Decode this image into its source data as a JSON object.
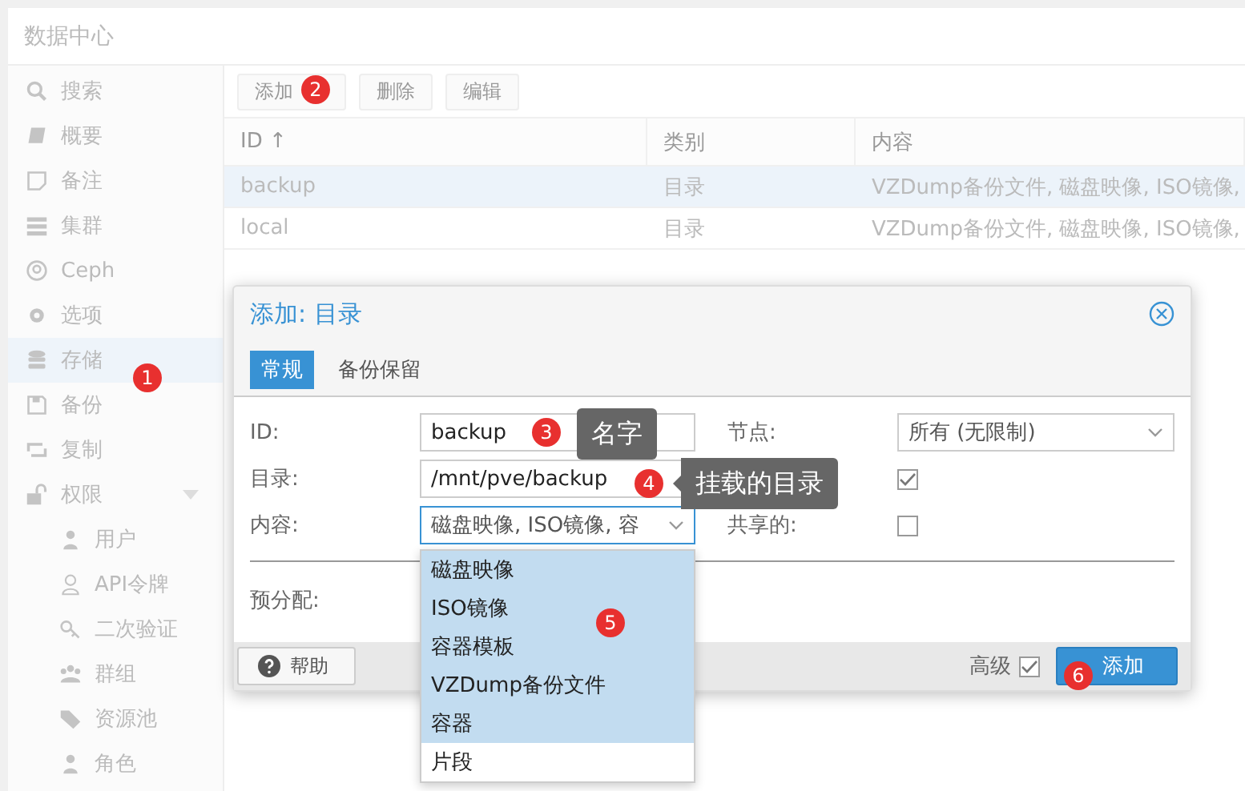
{
  "header": {
    "title": "数据中心"
  },
  "sidebar": {
    "items": [
      {
        "label": "搜索",
        "selected": false
      },
      {
        "label": "概要",
        "selected": false
      },
      {
        "label": "备注",
        "selected": false
      },
      {
        "label": "集群",
        "selected": false
      },
      {
        "label": "Ceph",
        "selected": false
      },
      {
        "label": "选项",
        "selected": false
      },
      {
        "label": "存储",
        "selected": true
      },
      {
        "label": "备份",
        "selected": false
      },
      {
        "label": "复制",
        "selected": false
      },
      {
        "label": "权限",
        "selected": false,
        "expanded": true,
        "children": [
          {
            "label": "用户",
            "selected": false
          },
          {
            "label": "API令牌",
            "selected": false
          },
          {
            "label": "二次验证",
            "selected": false
          },
          {
            "label": "群组",
            "selected": false
          },
          {
            "label": "资源池",
            "selected": false
          },
          {
            "label": "角色",
            "selected": false
          }
        ]
      }
    ]
  },
  "toolbar": {
    "buttons": [
      "添加",
      "删除",
      "编辑"
    ]
  },
  "table": {
    "columns": [
      "ID ↑",
      "类别",
      "内容"
    ],
    "rows": [
      {
        "cells": [
          "backup",
          "目录",
          "VZDump备份文件, 磁盘映像, ISO镜像,"
        ],
        "selected": true
      },
      {
        "cells": [
          "local",
          "目录",
          "VZDump备份文件, 磁盘映像, ISO镜像,"
        ],
        "selected": false
      }
    ]
  },
  "dialog": {
    "title": "添加: 目录",
    "tabs": [
      {
        "label": "常规",
        "selected": true
      },
      {
        "label": "备份保留",
        "selected": false
      }
    ],
    "left_fields": [
      {
        "kind": "text",
        "label": "ID:",
        "value": "backup"
      },
      {
        "kind": "text",
        "label": "目录:",
        "value": "/mnt/pve/backup"
      },
      {
        "kind": "combo",
        "label": "内容:",
        "value": "磁盘映像, ISO镜像, 容"
      }
    ],
    "right_fields": [
      {
        "kind": "combo",
        "label": "节点:",
        "value": "所有 (无限制)"
      },
      {
        "kind": "checkbox",
        "checked": true
      },
      {
        "kind": "checkbox",
        "label": "共享的:",
        "checked": false
      }
    ],
    "lower_fields": [
      {
        "label": "预分配:"
      }
    ],
    "help_button": "帮助",
    "advanced": {
      "label": "高级",
      "checked": true
    },
    "submit_button": "添加"
  },
  "dropdown": {
    "items": [
      {
        "label": "磁盘映像",
        "selected": true
      },
      {
        "label": "ISO镜像",
        "selected": true
      },
      {
        "label": "容器模板",
        "selected": true
      },
      {
        "label": "VZDump备份文件",
        "selected": true
      },
      {
        "label": "容器",
        "selected": true
      },
      {
        "label": "片段",
        "selected": false
      }
    ]
  },
  "markers": [
    "1",
    "2",
    "3",
    "4",
    "5",
    "6"
  ],
  "tooltips": [
    "名字",
    "挂载的目录"
  ]
}
